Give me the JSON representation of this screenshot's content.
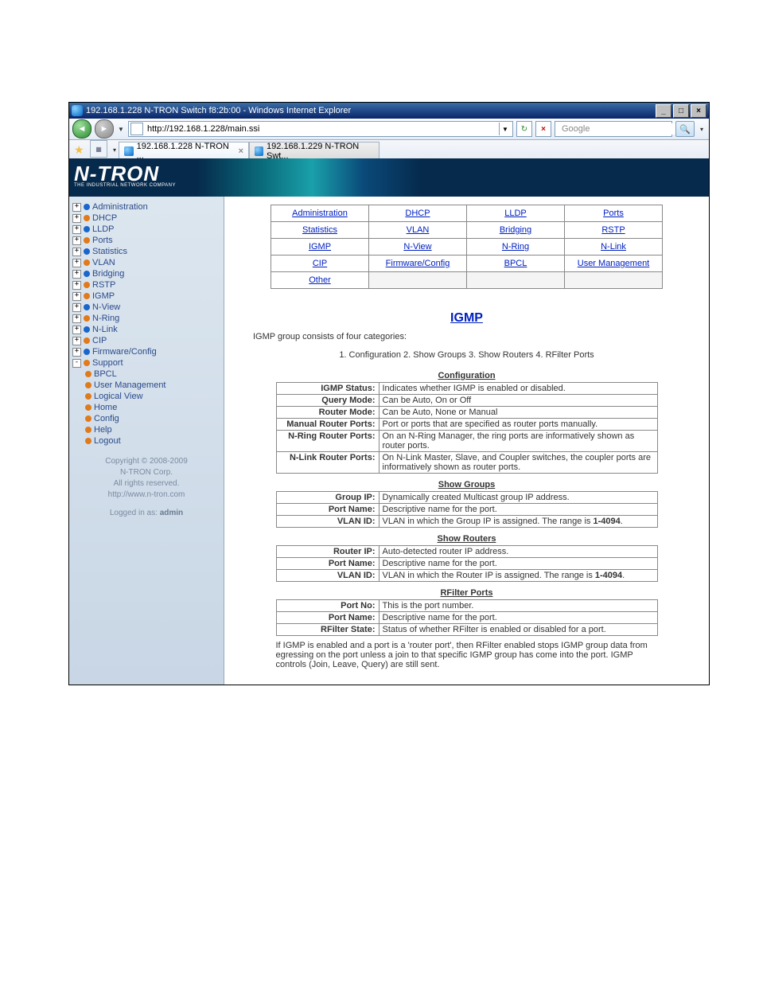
{
  "window": {
    "title": "192.168.1.228 N-TRON Switch f8:2b:00 - Windows Internet Explorer",
    "url": "http://192.168.1.228/main.ssi",
    "search_placeholder": "Google"
  },
  "tabs": [
    {
      "label": "192.168.1.228 N-TRON ...",
      "active": true,
      "closable": true
    },
    {
      "label": "192.168.1.229 N-TRON Swt...",
      "active": false,
      "closable": false
    }
  ],
  "logo": {
    "brand": "N-TRON",
    "tag": "THE INDUSTRIAL NETWORK COMPANY"
  },
  "tree": [
    {
      "label": "Administration",
      "exp": "+",
      "ball": "#1a66cc"
    },
    {
      "label": "DHCP",
      "exp": "+",
      "ball": "#e07a1a"
    },
    {
      "label": "LLDP",
      "exp": "+",
      "ball": "#1a66cc"
    },
    {
      "label": "Ports",
      "exp": "+",
      "ball": "#e07a1a"
    },
    {
      "label": "Statistics",
      "exp": "+",
      "ball": "#1a66cc"
    },
    {
      "label": "VLAN",
      "exp": "+",
      "ball": "#e07a1a"
    },
    {
      "label": "Bridging",
      "exp": "+",
      "ball": "#1a66cc"
    },
    {
      "label": "RSTP",
      "exp": "+",
      "ball": "#e07a1a"
    },
    {
      "label": "IGMP",
      "exp": "+",
      "ball": "#e07a1a"
    },
    {
      "label": "N-View",
      "exp": "+",
      "ball": "#1a66cc"
    },
    {
      "label": "N-Ring",
      "exp": "+",
      "ball": "#e07a1a"
    },
    {
      "label": "N-Link",
      "exp": "+",
      "ball": "#1a66cc"
    },
    {
      "label": "CIP",
      "exp": "+",
      "ball": "#e07a1a"
    },
    {
      "label": "Firmware/Config",
      "exp": "+",
      "ball": "#1a66cc"
    },
    {
      "label": "Support",
      "exp": "-",
      "ball": "#e07a1a"
    }
  ],
  "tree_sub": [
    {
      "label": "BPCL",
      "ball": "#e07a1a"
    },
    {
      "label": "User Management",
      "ball": "#e07a1a"
    },
    {
      "label": "Logical View",
      "ball": "#e07a1a"
    },
    {
      "label": "Home",
      "ball": "#e07a1a"
    },
    {
      "label": "Config",
      "ball": "#e07a1a"
    },
    {
      "label": "Help",
      "ball": "#e07a1a"
    },
    {
      "label": "Logout",
      "ball": "#e07a1a"
    }
  ],
  "copyright": {
    "line1": "Copyright © 2008-2009",
    "line2": "N-TRON Corp.",
    "line3": "All rights reserved.",
    "url": "http://www.n-tron.com"
  },
  "login": {
    "prefix": "Logged in as:",
    "user": "admin"
  },
  "navgrid": [
    [
      "Administration",
      "DHCP",
      "LLDP",
      "Ports"
    ],
    [
      "Statistics",
      "VLAN",
      "Bridging",
      "RSTP"
    ],
    [
      "IGMP",
      "N-View",
      "N-Ring",
      "N-Link"
    ],
    [
      "CIP",
      "Firmware/Config",
      "BPCL",
      "User Management"
    ],
    [
      "Other",
      "",
      "",
      ""
    ]
  ],
  "page": {
    "title": "IGMP",
    "intro": "IGMP group consists of four categories:",
    "categories": "1. Configuration   2. Show Groups   3. Show Routers   4. RFilter Ports"
  },
  "sections": [
    {
      "title": "Configuration",
      "rows": [
        {
          "label": "IGMP Status:",
          "text": "Indicates whether IGMP is enabled or disabled."
        },
        {
          "label": "Query Mode:",
          "text": "Can be Auto, On or Off"
        },
        {
          "label": "Router Mode:",
          "text": "Can be Auto, None or Manual"
        },
        {
          "label": "Manual Router Ports:",
          "text": "Port or ports that are specified as router ports manually."
        },
        {
          "label": "N-Ring Router Ports:",
          "text": "On an N-Ring Manager, the ring ports are informatively shown as router ports."
        },
        {
          "label": "N-Link Router Ports:",
          "text": "On N-Link Master, Slave, and Coupler switches, the coupler ports are informatively shown as router ports."
        }
      ]
    },
    {
      "title": "Show Groups",
      "rows": [
        {
          "label": "Group IP:",
          "text": "Dynamically created Multicast group IP address."
        },
        {
          "label": "Port Name:",
          "text": "Descriptive name for the port."
        },
        {
          "label": "VLAN ID:",
          "text": "VLAN in which the Group IP is assigned. The range is 1-4094."
        }
      ]
    },
    {
      "title": "Show Routers",
      "rows": [
        {
          "label": "Router IP:",
          "text": "Auto-detected router IP address."
        },
        {
          "label": "Port Name:",
          "text": "Descriptive name for the port."
        },
        {
          "label": "VLAN ID:",
          "text": "VLAN in which the Router IP is assigned. The range is 1-4094."
        }
      ]
    },
    {
      "title": "RFilter Ports",
      "rows": [
        {
          "label": "Port No:",
          "text": "This is the port number."
        },
        {
          "label": "Port Name:",
          "text": "Descriptive name for the port."
        },
        {
          "label": "RFilter State:",
          "text": "Status of whether RFilter is enabled or disabled for a port."
        }
      ],
      "note": "If IGMP is enabled and a port is a 'router port', then RFilter enabled stops IGMP group data from egressing on the port unless a join to that specific IGMP group has come into the port. IGMP controls (Join, Leave, Query) are still sent."
    }
  ]
}
